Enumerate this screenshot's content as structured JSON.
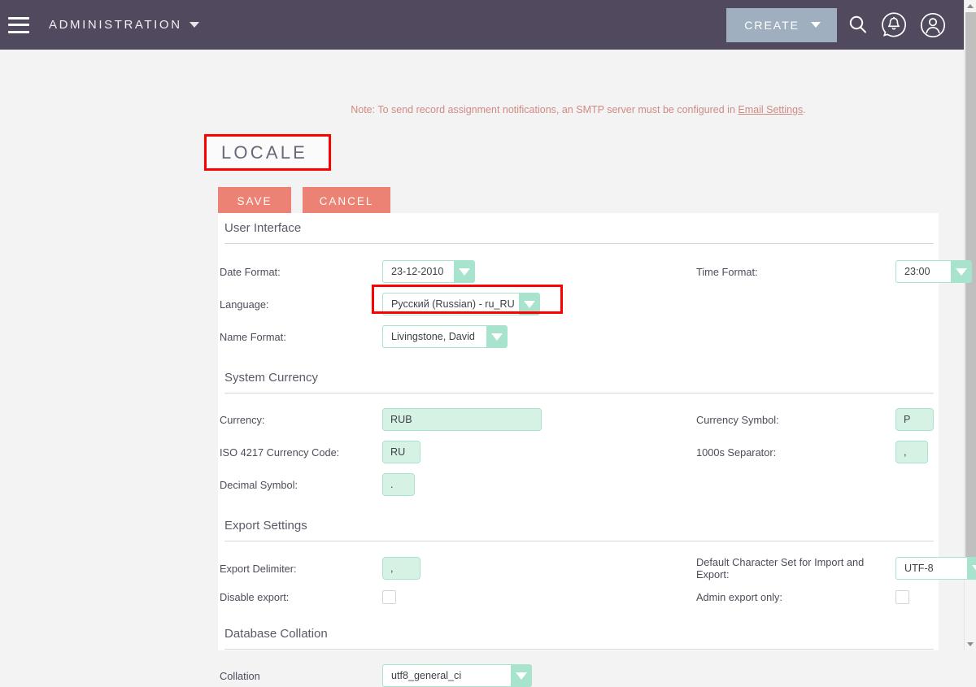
{
  "topbar": {
    "menu_icon": "hamburger-icon",
    "module_title": "ADMINISTRATION",
    "create_label": "CREATE",
    "search_icon": "search-icon",
    "notifications_icon": "bell-notification-icon",
    "profile_icon": "user-avatar-icon",
    "background_color": "#514a5e",
    "create_button_color": "#9fafbf"
  },
  "note": {
    "text_before_link": "Note: To send record assignment notifications, an SMTP server must be configured in ",
    "link_text": "Email Settings",
    "text_after_link": ".",
    "color": "#d08b83"
  },
  "page": {
    "title": "LOCALE",
    "highlight_color": "#ff0000"
  },
  "actions": {
    "save_label": "SAVE",
    "cancel_label": "CANCEL",
    "button_color": "#ec8274"
  },
  "sections": [
    {
      "heading": "User Interface",
      "fields": [
        {
          "label": "Date Format:",
          "type": "select",
          "value": "23-12-2010",
          "value_width": 88,
          "label2": "Time Format:",
          "type2": "select",
          "value2": "23:00",
          "value2_width": 68
        },
        {
          "label": "Language:",
          "type": "select",
          "value": "Русский (Russian) - ru_RU",
          "value_width": 168,
          "highlighted": true
        },
        {
          "label": "Name Format:",
          "type": "select",
          "value": "Livingstone, David",
          "value_width": 128
        }
      ]
    },
    {
      "heading": "System Currency",
      "fields": [
        {
          "label": "Currency:",
          "type": "text",
          "value": "RUB",
          "value_width": 196,
          "label2": "Currency Symbol:",
          "type2": "text",
          "value2": "P",
          "value2_width": 47
        },
        {
          "label": "ISO 4217 Currency Code:",
          "type": "text",
          "value": "RU",
          "value_width": 47,
          "label2": "1000s Separator:",
          "type2": "text",
          "value2": ",",
          "value2_width": 40
        },
        {
          "label": "Decimal Symbol:",
          "type": "text",
          "value": ".",
          "value_width": 40
        }
      ]
    },
    {
      "heading": "Export Settings",
      "fields": [
        {
          "label": "Export Delimiter:",
          "type": "text",
          "value": ",",
          "value_width": 47,
          "label2": "Default Character Set for Import and Export:",
          "type2": "select",
          "value2": "UTF-8",
          "value2_width": 88
        },
        {
          "label": "Disable export:",
          "type": "checkbox",
          "value": "",
          "label2": "Admin export only:",
          "type2": "checkbox",
          "value2": ""
        }
      ]
    },
    {
      "heading": "Database Collation",
      "fields": [
        {
          "label": "Collation",
          "type": "select",
          "value": "utf8_general_ci",
          "value_width": 158
        }
      ]
    }
  ],
  "scrollbar": {
    "name": "vertical-scrollbar"
  }
}
